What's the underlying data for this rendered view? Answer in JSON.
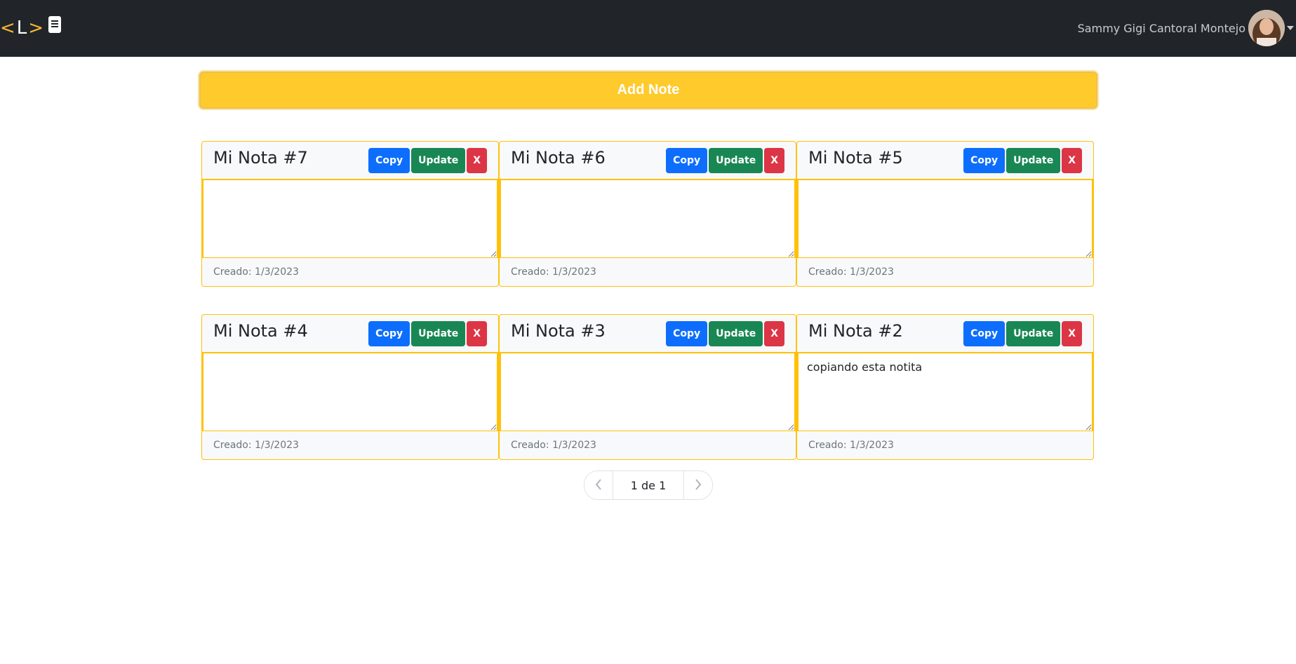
{
  "nav": {
    "brand_lt": "<",
    "brand_letter": "L",
    "brand_gt": ">",
    "user_name": "Sammy Gigi Cantoral Montejo"
  },
  "actions": {
    "add_note_label": "Add Note"
  },
  "buttons": {
    "copy": "Copy",
    "update": "Update",
    "delete": "X"
  },
  "notes": [
    {
      "title": "Mi Nota #7",
      "content": "",
      "created": "Creado: 1/3/2023"
    },
    {
      "title": "Mi Nota #6",
      "content": "",
      "created": "Creado: 1/3/2023"
    },
    {
      "title": "Mi Nota #5",
      "content": "",
      "created": "Creado: 1/3/2023"
    },
    {
      "title": "Mi Nota #4",
      "content": "",
      "created": "Creado: 1/3/2023"
    },
    {
      "title": "Mi Nota #3",
      "content": "",
      "created": "Creado: 1/3/2023"
    },
    {
      "title": "Mi Nota #2",
      "content": "copiando esta notita",
      "created": "Creado: 1/3/2023"
    }
  ],
  "pagination": {
    "label": "1 de 1"
  },
  "colors": {
    "navbar": "#212529",
    "accent": "#ffc107",
    "copy": "#0d6efd",
    "update": "#198754",
    "delete": "#dc3545"
  },
  "icons": {
    "brand": "book-icon",
    "prev": "chevron-left-icon",
    "next": "chevron-right-icon",
    "user_menu": "caret-down-icon"
  }
}
